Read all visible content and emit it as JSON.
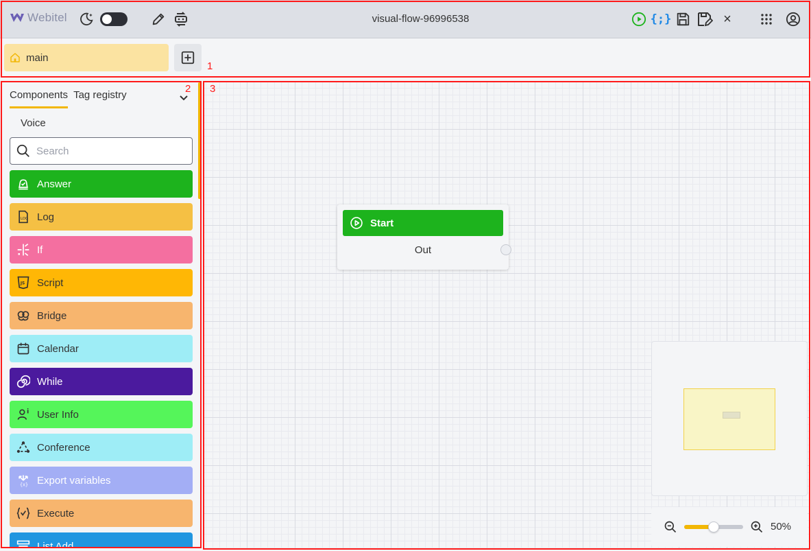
{
  "header": {
    "brand": "Webitel",
    "flow_name": "visual-flow-96996538",
    "json_icon_text": "{;}",
    "close_glyph": "×"
  },
  "tabs": {
    "main_label": "main"
  },
  "regions": {
    "one": "1",
    "two": "2",
    "three": "3"
  },
  "sidebar": {
    "tabs": [
      "Components",
      "Tag registry"
    ],
    "category": "Voice",
    "search_placeholder": "Search",
    "components": [
      {
        "label": "Answer",
        "bg": "#1db31d",
        "fg": "#ffffff",
        "icon": "bell-check-icon"
      },
      {
        "label": "Log",
        "bg": "#f5c044",
        "fg": "#333333",
        "icon": "log-file-icon"
      },
      {
        "label": "If",
        "bg": "#f46fa0",
        "fg": "#ffffff",
        "icon": "branch-icon"
      },
      {
        "label": "Script",
        "bg": "#ffb705",
        "fg": "#333333",
        "icon": "js-script-icon"
      },
      {
        "label": "Bridge",
        "bg": "#f7b56e",
        "fg": "#333333",
        "icon": "bridge-icon"
      },
      {
        "label": "Calendar",
        "bg": "#9eedf6",
        "fg": "#333333",
        "icon": "calendar-icon"
      },
      {
        "label": "While",
        "bg": "#4b1a9e",
        "fg": "#ffffff",
        "icon": "spiral-icon"
      },
      {
        "label": "User Info",
        "bg": "#55f55a",
        "fg": "#333333",
        "icon": "user-info-icon"
      },
      {
        "label": "Conference",
        "bg": "#9eedf6",
        "fg": "#333333",
        "icon": "conference-icon"
      },
      {
        "label": "Export variables",
        "bg": "#a3aef5",
        "fg": "#ffffff",
        "icon": "export-variables-icon"
      },
      {
        "label": "Execute",
        "bg": "#f7b56e",
        "fg": "#333333",
        "icon": "execute-icon"
      },
      {
        "label": "List Add",
        "bg": "#2196e0",
        "fg": "#ffffff",
        "icon": "list-add-icon"
      }
    ]
  },
  "canvas": {
    "start_node": {
      "title": "Start",
      "output_label": "Out"
    },
    "zoom": {
      "label": "50%",
      "level": 0.5
    }
  },
  "colors": {
    "accent": "#f2b705",
    "start_green": "#1db31d",
    "annotation_red": "#ff1a1a"
  }
}
